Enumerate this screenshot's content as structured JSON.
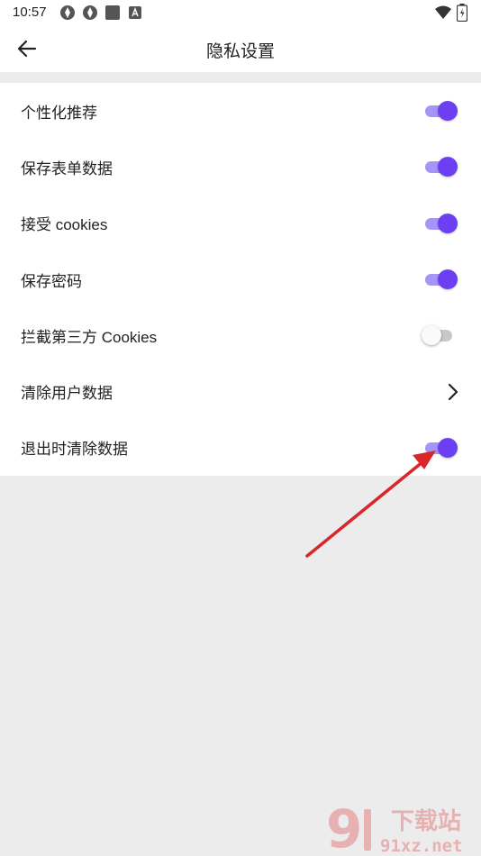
{
  "status_bar": {
    "time": "10:57"
  },
  "app_bar": {
    "title": "隐私设置"
  },
  "settings": [
    {
      "label": "个性化推荐",
      "type": "toggle",
      "on": true
    },
    {
      "label": "保存表单数据",
      "type": "toggle",
      "on": true
    },
    {
      "label": "接受 cookies",
      "type": "toggle",
      "on": true
    },
    {
      "label": "保存密码",
      "type": "toggle",
      "on": true
    },
    {
      "label": "拦截第三方 Cookies",
      "type": "toggle",
      "on": false
    },
    {
      "label": "清除用户数据",
      "type": "link"
    },
    {
      "label": "退出时清除数据",
      "type": "toggle",
      "on": true
    }
  ],
  "colors": {
    "accent": "#6c3ff2",
    "accent_track": "#a495f7",
    "annotation_arrow": "#d9262b"
  },
  "watermark": {
    "logo_text": "9",
    "title": "下载站",
    "domain": "91xz.net"
  }
}
